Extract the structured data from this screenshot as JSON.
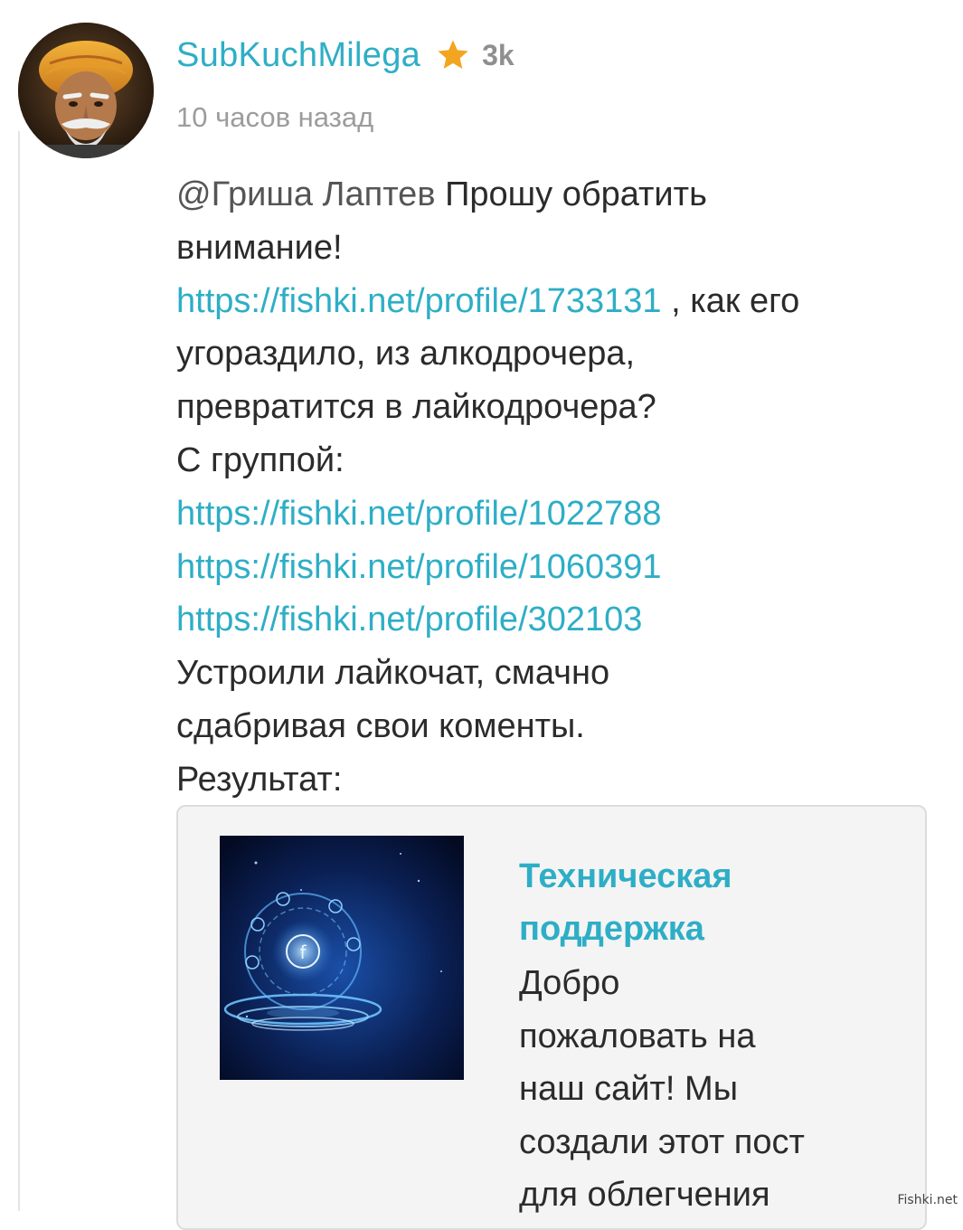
{
  "author": {
    "name": "SubKuchMilega",
    "rating": "3k",
    "rating_icon": "star-icon",
    "avatar_icon": "avatar-portrait"
  },
  "timestamp": "10 часов назад",
  "comment": {
    "line1_mention": "@Гриша Лаптев",
    "line1_text": " Прошу обратить",
    "line2": "внимание!",
    "line3_link": "https://fishki.net/profile/1733131",
    "line3_text": " , как его",
    "line4": "угораздило, из алкодрочера,",
    "line5": "превратится в лайкодрочера?",
    "line6": "С группой:",
    "link_a": "https://fishki.net/profile/1022788",
    "link_b": "https://fishki.net/profile/1060391",
    "link_c": "https://fishki.net/profile/302103",
    "line10": "Устроили лайкочат, смачно",
    "line11": "сдабривая свои коменты.",
    "line12": "Результат:"
  },
  "preview": {
    "title_line1": "Техническая",
    "title_line2": "поддержка",
    "desc_lines": [
      "Добро",
      "пожаловать на",
      "наш сайт! Мы",
      "создали этот пост",
      "для облегчения"
    ]
  },
  "watermark": "Fishki.net",
  "colors": {
    "link": "#2eaec6",
    "text": "#2b2b2b",
    "muted": "#9c9c9c",
    "star": "#f2a51e"
  }
}
